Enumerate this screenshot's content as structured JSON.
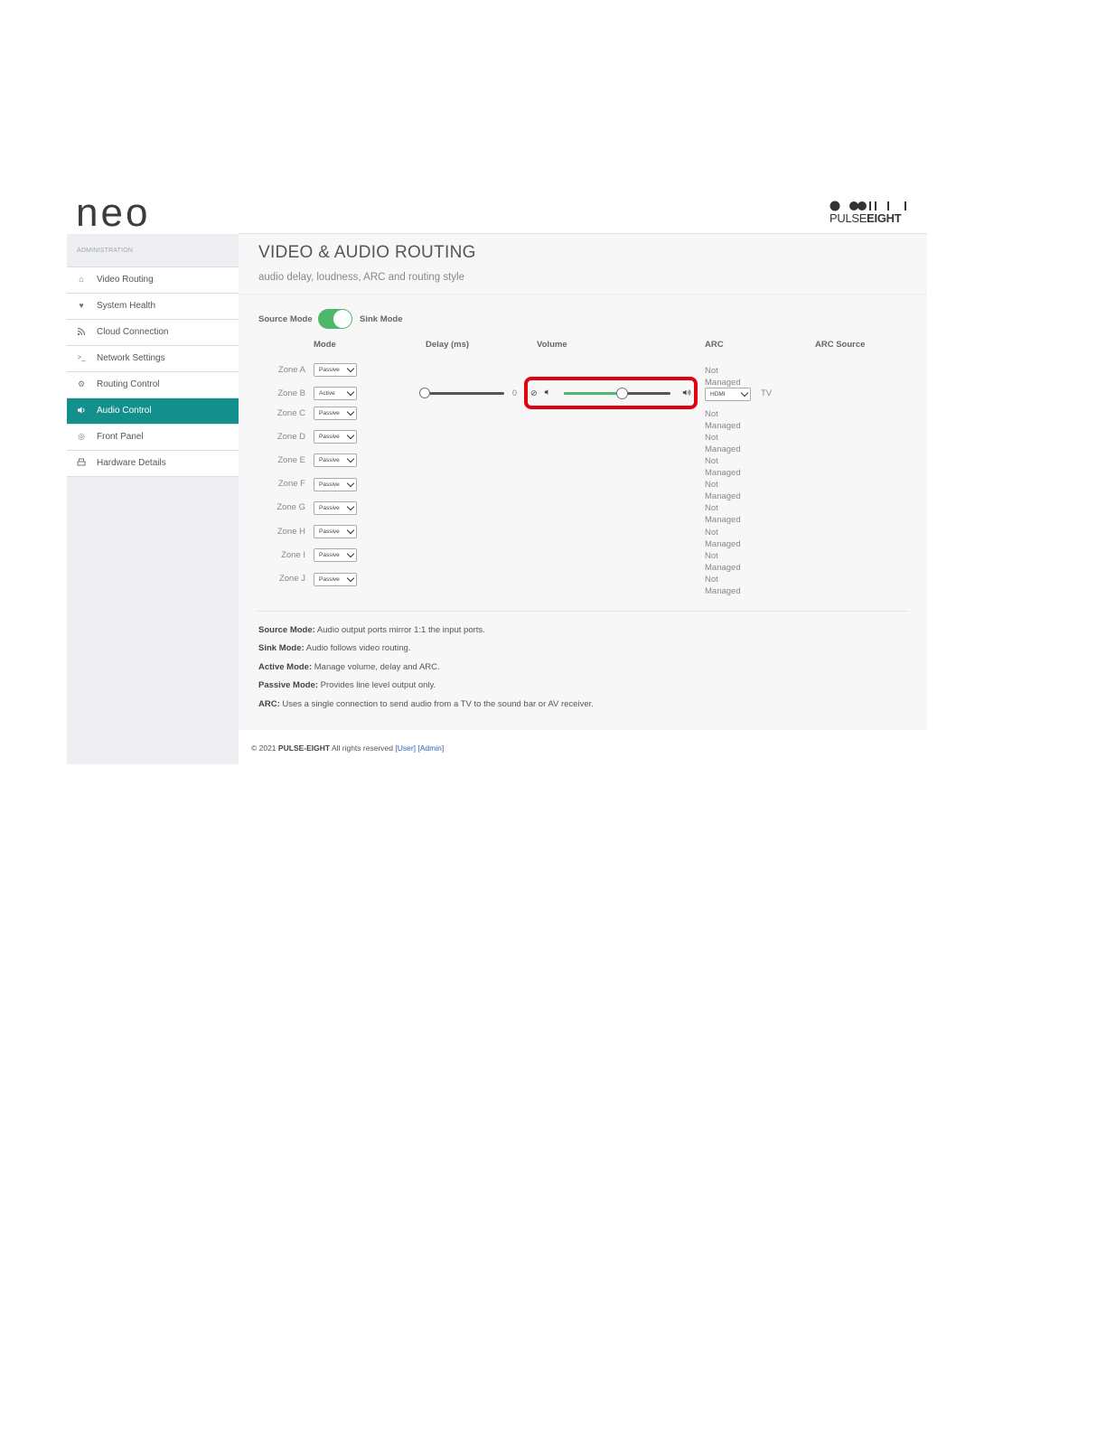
{
  "app": {
    "logo": "neo",
    "brand_light": "PULSE",
    "brand_bold": "EIGHT"
  },
  "sidebar": {
    "header": "ADMINISTRATION",
    "items": [
      {
        "label": "Video Routing",
        "icon": "home-icon",
        "active": false
      },
      {
        "label": "System Health",
        "icon": "heart-icon",
        "active": false
      },
      {
        "label": "Cloud Connection",
        "icon": "rss-icon",
        "active": false
      },
      {
        "label": "Network Settings",
        "icon": "terminal-icon",
        "active": false
      },
      {
        "label": "Routing Control",
        "icon": "gears-icon",
        "active": false
      },
      {
        "label": "Audio Control",
        "icon": "volume-icon",
        "active": true
      },
      {
        "label": "Front Panel",
        "icon": "target-icon",
        "active": false
      },
      {
        "label": "Hardware Details",
        "icon": "printer-icon",
        "active": false
      }
    ]
  },
  "page": {
    "title": "VIDEO & AUDIO ROUTING",
    "subtitle": "audio delay, loudness, ARC and routing style"
  },
  "toggle": {
    "left_label": "Source Mode",
    "right_label": "Sink Mode",
    "state": "Sink Mode"
  },
  "table": {
    "headers": {
      "mode": "Mode",
      "delay": "Delay (ms)",
      "volume": "Volume",
      "arc": "ARC",
      "arc_source": "ARC Source"
    },
    "zones": [
      {
        "name": "Zone A",
        "mode": "Passive",
        "arc_line1": "Not",
        "arc_line2": "Managed"
      },
      {
        "name": "Zone B",
        "mode": "Active",
        "delay_value": "0",
        "arc_select": "HDMI",
        "arc_source": "TV"
      },
      {
        "name": "Zone C",
        "mode": "Passive",
        "arc_line1": "Not",
        "arc_line2": "Managed"
      },
      {
        "name": "Zone D",
        "mode": "Passive",
        "arc_line1": "Not",
        "arc_line2": "Managed"
      },
      {
        "name": "Zone E",
        "mode": "Passive",
        "arc_line1": "Not",
        "arc_line2": "Managed"
      },
      {
        "name": "Zone F",
        "mode": "Passive",
        "arc_line1": "Not",
        "arc_line2": "Managed"
      },
      {
        "name": "Zone G",
        "mode": "Passive",
        "arc_line1": "Not",
        "arc_line2": "Managed"
      },
      {
        "name": "Zone H",
        "mode": "Passive",
        "arc_line1": "Not",
        "arc_line2": "Managed"
      },
      {
        "name": "Zone I",
        "mode": "Passive",
        "arc_line1": "Not",
        "arc_line2": "Managed"
      },
      {
        "name": "Zone J",
        "mode": "Passive",
        "arc_line1": "Not",
        "arc_line2": "Managed"
      }
    ],
    "zone_b_delay_fraction": 0.0,
    "zone_b_volume_fraction": 0.54
  },
  "legend": [
    {
      "term": "Source Mode:",
      "text": " Audio output ports mirror 1:1 the input ports."
    },
    {
      "term": "Sink Mode:",
      "text": " Audio follows video routing."
    },
    {
      "term": "Active Mode:",
      "text": " Manage volume, delay and ARC."
    },
    {
      "term": "Passive Mode:",
      "text": " Provides line level output only."
    },
    {
      "term": "ARC:",
      "text": " Uses a single connection to send audio from a TV to the sound bar or AV receiver."
    }
  ],
  "footer": {
    "prefix": "© 2021 ",
    "company": "PULSE-EIGHT",
    "rights": " All rights reserved ",
    "user_link": "[User]",
    "admin_link": "[Admin]"
  },
  "colors": {
    "accent": "#138f8c",
    "toggle_on": "#4cb86a",
    "highlight": "#e3000f",
    "link": "#2a62b9"
  }
}
